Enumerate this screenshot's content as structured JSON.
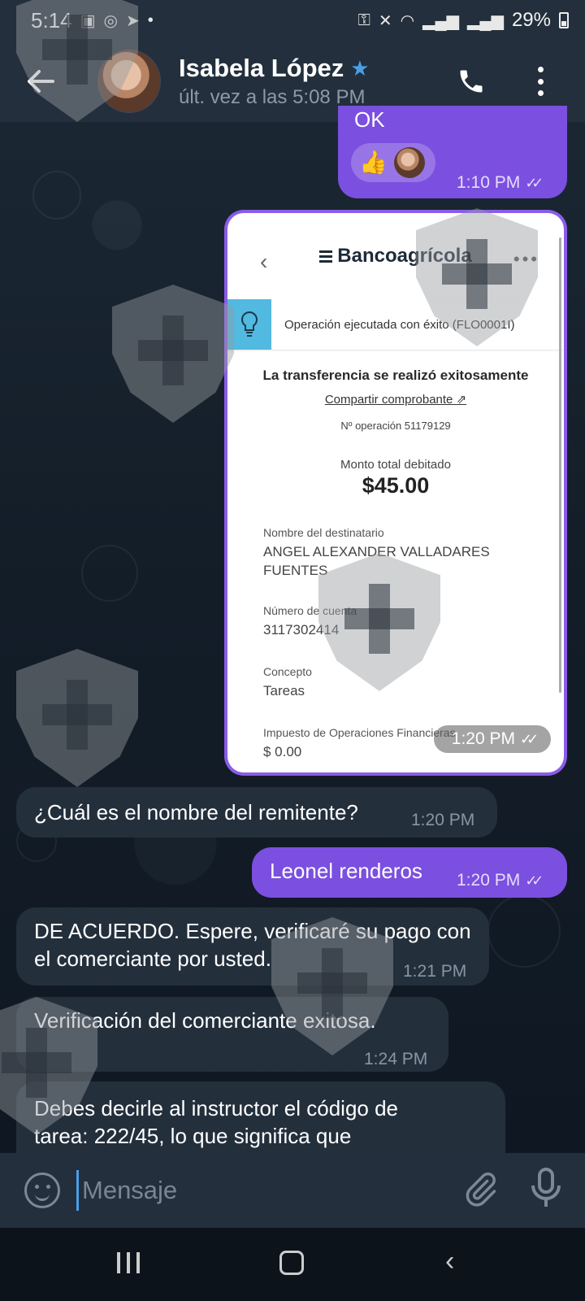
{
  "status_bar": {
    "time": "5:14",
    "battery": "29%"
  },
  "header": {
    "contact_name": "Isabela López",
    "last_seen": "últ. vez a las 5:08 PM"
  },
  "messages": {
    "ok_partial": "OK",
    "ok_time": "1:10 PM",
    "receipt_time": "1:20 PM",
    "q_sender": "¿Cuál es el nombre del remitente?",
    "q_sender_time": "1:20 PM",
    "reply_sender": "Leonel renderos",
    "reply_sender_time": "1:20 PM",
    "agreed": "DE ACUERDO. Espere, verificaré su pago con el comerciante por usted.",
    "agreed_time": "1:21 PM",
    "verified": "Verificación del comerciante exitosa.",
    "verified_time": "1:24 PM",
    "instruction": "Debes decirle al instructor el código de tarea: 222/45, lo que significa que participaste en el pedido prepago y él te"
  },
  "receipt": {
    "bank": "Bancoagrícola",
    "alert": "Operación ejecutada con éxito (FLO0001I)",
    "title": "La transferencia se realizó exitosamente",
    "share": "Compartir comprobante",
    "op_number": "Nº operación 51179129",
    "amount_label": "Monto total debitado",
    "amount": "$45.00",
    "recipient_label": "Nombre del destinatario",
    "recipient": "ANGEL ALEXANDER VALLADARES FUENTES",
    "account_label": "Número de cuenta",
    "account": "3117302414",
    "concept_label": "Concepto",
    "concept": "Tareas",
    "tax_label": "Impuesto de Operaciones Financieras",
    "tax": "$ 0.00"
  },
  "input": {
    "placeholder": "Mensaje"
  },
  "icons": {
    "back": "arrow-left-icon",
    "phone": "phone-icon",
    "menu": "more-vert-icon",
    "emoji": "emoji-icon",
    "attach": "paperclip-icon",
    "mic": "microphone-icon"
  },
  "colors": {
    "outgoing_bubble": "#7b4fdf",
    "incoming_bubble": "#242f3c",
    "header": "#232f3c",
    "accent": "#4a9ee8"
  }
}
